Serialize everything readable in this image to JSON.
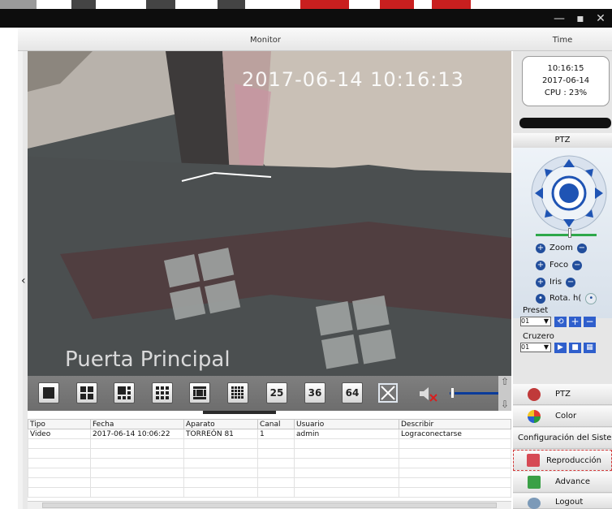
{
  "window": {
    "controls": [
      "—",
      "▪",
      "✕"
    ]
  },
  "header": {
    "monitor": "Monitor",
    "time": "Time"
  },
  "video": {
    "timestamp": "2017-06-14 10:16:13",
    "camera_name": "Puerta Principal"
  },
  "toolbar": {
    "layouts": [
      "1",
      "4",
      "6",
      "9",
      "13",
      "16"
    ],
    "grid_numbers": [
      "25",
      "36",
      "64"
    ]
  },
  "log": {
    "columns": [
      "Tipo",
      "Fecha",
      "Aparato",
      "Canal",
      "Usuario",
      "Describir"
    ],
    "rows": [
      [
        "Video",
        "2017-06-14 10:06:22",
        "TORREÓN 81",
        "1",
        "admin",
        "Lograconectarse"
      ]
    ]
  },
  "clock": {
    "time": "10:16:15",
    "date": "2017-06-14",
    "cpu": "CPU : 23%"
  },
  "ptz": {
    "title": "PTZ",
    "zoom": "Zoom",
    "focus": "Foco",
    "iris": "Iris",
    "rotate": "Rota. h(",
    "preset_label": "Preset",
    "preset_value": "01",
    "cruise_label": "Cruzero",
    "cruise_value": "01"
  },
  "menu": {
    "items": [
      {
        "label": "PTZ",
        "icon": "ptz-icon"
      },
      {
        "label": "Color",
        "icon": "color-icon"
      },
      {
        "label": "Configuración del Sistema",
        "icon": "config-icon"
      },
      {
        "label": "Reproducción",
        "icon": "playback-icon"
      },
      {
        "label": "Advance",
        "icon": "advance-icon"
      },
      {
        "label": "Logout",
        "icon": "logout-icon"
      }
    ]
  },
  "colors": {
    "accent_blue": "#2f5fcc",
    "selected_border": "#d23b3b"
  }
}
